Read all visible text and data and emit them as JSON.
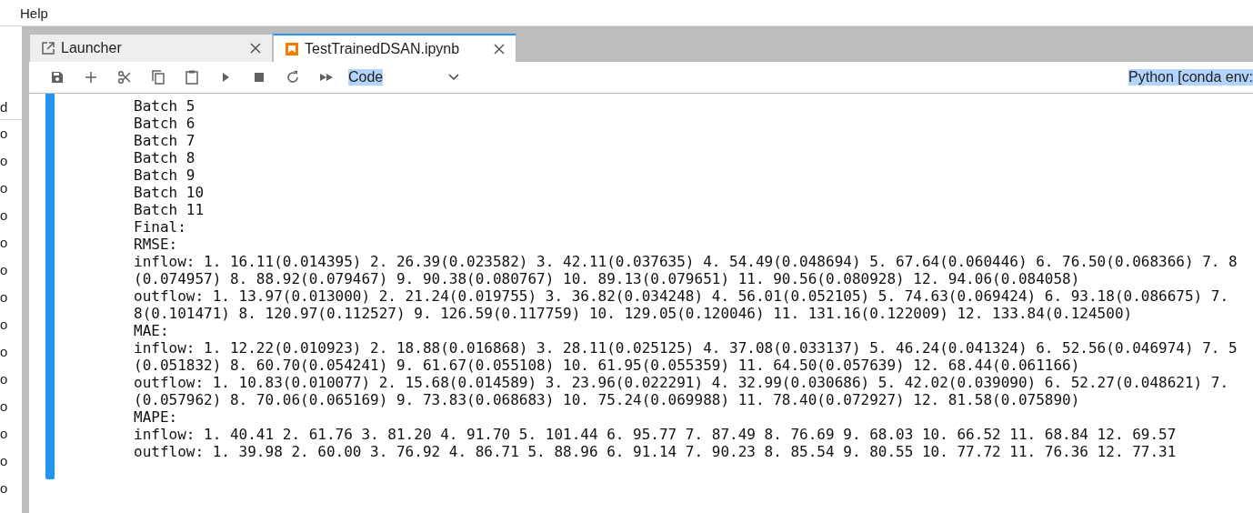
{
  "menu_bar": [
    "Help"
  ],
  "sidebar": {
    "items": [
      "d",
      "o",
      "o",
      "o",
      "o",
      "o",
      "o",
      "o",
      "o",
      "o",
      "o",
      "o",
      "o",
      "o",
      "o"
    ]
  },
  "tabs": [
    {
      "label": "Launcher",
      "kind": "launcher",
      "selected": false
    },
    {
      "label": "TestTrainedDSAN.ipynb",
      "kind": "notebook",
      "selected": true
    }
  ],
  "toolbar": {
    "cell_type": "Code",
    "kernel": "Python [conda env:"
  },
  "output": [
    "Batch 5",
    "Batch 6",
    "Batch 7",
    "Batch 8",
    "Batch 9",
    "Batch 10",
    "Batch 11",
    "Final:",
    "RMSE:",
    "inflow: 1. 16.11(0.014395) 2. 26.39(0.023582) 3. 42.11(0.037635) 4. 54.49(0.048694) 5. 67.64(0.060446) 6. 76.50(0.068366) 7. 8",
    "(0.074957) 8. 88.92(0.079467) 9. 90.38(0.080767) 10. 89.13(0.079651) 11. 90.56(0.080928) 12. 94.06(0.084058)",
    "outflow: 1. 13.97(0.013000) 2. 21.24(0.019755) 3. 36.82(0.034248) 4. 56.01(0.052105) 5. 74.63(0.069424) 6. 93.18(0.086675) 7.",
    "8(0.101471) 8. 120.97(0.112527) 9. 126.59(0.117759) 10. 129.05(0.120046) 11. 131.16(0.122009) 12. 133.84(0.124500)",
    "MAE:",
    "inflow: 1. 12.22(0.010923) 2. 18.88(0.016868) 3. 28.11(0.025125) 4. 37.08(0.033137) 5. 46.24(0.041324) 6. 52.56(0.046974) 7. 5",
    "(0.051832) 8. 60.70(0.054241) 9. 61.67(0.055108) 10. 61.95(0.055359) 11. 64.50(0.057639) 12. 68.44(0.061166)",
    "outflow: 1. 10.83(0.010077) 2. 15.68(0.014589) 3. 23.96(0.022291) 4. 32.99(0.030686) 5. 42.02(0.039090) 6. 52.27(0.048621) 7.",
    "(0.057962) 8. 70.06(0.065169) 9. 73.83(0.068683) 10. 75.24(0.069988) 11. 78.40(0.072927) 12. 81.58(0.075890)",
    "MAPE:",
    "inflow: 1. 40.41 2. 61.76 3. 81.20 4. 91.70 5. 101.44 6. 95.77 7. 87.49 8. 76.69 9. 68.03 10. 66.52 11. 68.84 12. 69.57",
    "outflow: 1. 39.98 2. 60.00 3. 76.92 4. 86.71 5. 88.96 6. 91.14 7. 90.23 8. 85.54 9. 80.55 10. 77.72 11. 76.36 12. 77.31"
  ]
}
